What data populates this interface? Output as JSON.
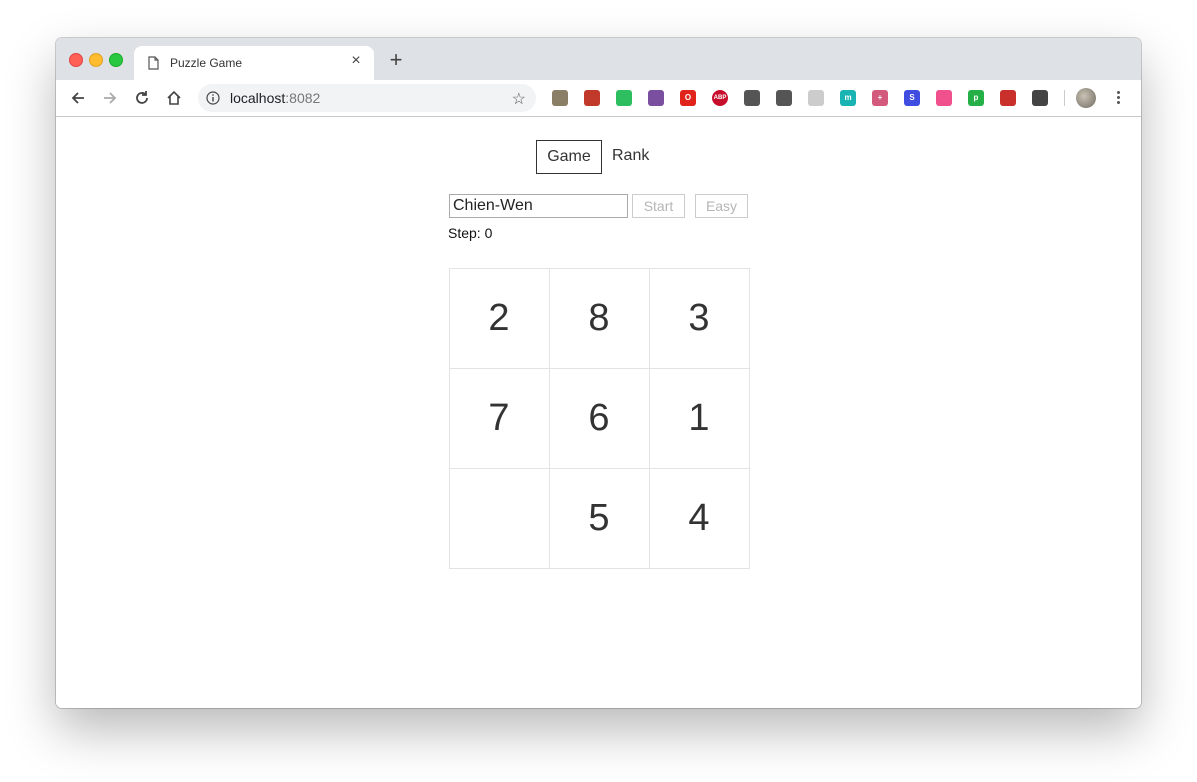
{
  "browser": {
    "tab_title": "Puzzle Game",
    "tab_close": "×",
    "new_tab": "+",
    "url_host": "localhost",
    "url_port": ":8082",
    "extensions": [
      {
        "name": "extension-1-icon",
        "color": "#8a7f66",
        "glyph": ""
      },
      {
        "name": "extension-2-icon",
        "color": "#c0392b",
        "glyph": ""
      },
      {
        "name": "evernote-icon",
        "color": "#2dbe60",
        "glyph": ""
      },
      {
        "name": "cursor-extension-icon",
        "color": "#7b4fa0",
        "glyph": ""
      },
      {
        "name": "opera-icon",
        "color": "#e0241b",
        "glyph": "O"
      },
      {
        "name": "adblock-plus-icon",
        "color": "#c70d2c",
        "glyph": "ABP"
      },
      {
        "name": "move-tool-icon",
        "color": "#555555",
        "glyph": ""
      },
      {
        "name": "pocket-icon",
        "color": "#555555",
        "glyph": ""
      },
      {
        "name": "extension-mail-icon",
        "color": "#cccccc",
        "glyph": ""
      },
      {
        "name": "extension-m-icon",
        "color": "#1ab3b3",
        "glyph": "m"
      },
      {
        "name": "extension-cross-icon",
        "color": "#d35a7d",
        "glyph": "+"
      },
      {
        "name": "extension-s-icon",
        "color": "#3f4de0",
        "glyph": "S"
      },
      {
        "name": "extension-cat-icon",
        "color": "#f0508c",
        "glyph": ""
      },
      {
        "name": "extension-p-icon",
        "color": "#24b047",
        "glyph": "p"
      },
      {
        "name": "extension-red-icon",
        "color": "#c9302c",
        "glyph": ""
      },
      {
        "name": "extension-bulb-icon",
        "color": "#444444",
        "glyph": ""
      }
    ]
  },
  "nav": {
    "game_label": "Game",
    "rank_label": "Rank"
  },
  "controls": {
    "name_value": "Chien-Wen",
    "start_label": "Start",
    "difficulty_label": "Easy",
    "step_label": "Step: 0"
  },
  "board": {
    "tiles": [
      "2",
      "8",
      "3",
      "7",
      "6",
      "1",
      "",
      "5",
      "4"
    ]
  }
}
